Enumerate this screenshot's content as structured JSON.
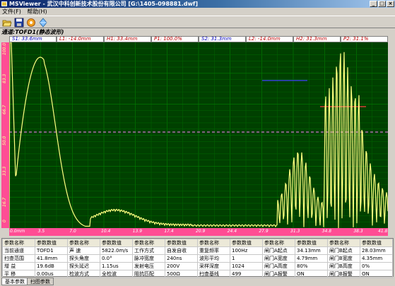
{
  "window": {
    "title": "MSViewer - 武汉中科创新技术股份有限公司 [G:\\1405-098881.dwf]"
  },
  "menu": {
    "items": [
      "文件(F)",
      "帮助(H)"
    ]
  },
  "toolbar": {
    "icons": [
      "open-folder-icon",
      "save-disk-icon",
      "settings-gear-icon",
      "diamond-icon"
    ]
  },
  "channel": {
    "label": "通道:TOFD1(静态波形)"
  },
  "readouts": [
    {
      "key": "s1",
      "text": "S1: 33.6mm"
    },
    {
      "key": "l1",
      "text": "L1: -14.0mm"
    },
    {
      "key": "h1",
      "text": "H1: 33.4mm"
    },
    {
      "key": "p1",
      "text": "P1: 100.0%"
    },
    {
      "key": "s2",
      "text": "S2: 31.3mm"
    },
    {
      "key": "l2",
      "text": "L2: -14.0mm"
    },
    {
      "key": "h2",
      "text": "H2: 31.3mm"
    },
    {
      "key": "p2",
      "text": "P2: 31.1%"
    }
  ],
  "plot": {
    "y_ticks": [
      "100.0",
      "83.3",
      "66.7",
      "50.0",
      "33.3",
      "16.7",
      "0"
    ],
    "x_ticks": [
      "0.0mm",
      "3.5",
      "7.0",
      "10.4",
      "13.9",
      "17.4",
      "20.9",
      "24.4",
      "27.9",
      "31.3",
      "34.8",
      "38.3",
      "41.8"
    ],
    "colors": {
      "background": "#004000",
      "grid": "#008000",
      "axis": "#ff4d94",
      "waveform": "#ffff80",
      "cursor": "#ff8080",
      "gate_a": "#4040ff",
      "gate_b": "#ff4040",
      "midline": "#ff80ff"
    }
  },
  "params": {
    "headers": [
      "参数名称",
      "参数数值",
      "参数名称",
      "参数数值",
      "参数名称",
      "参数数值",
      "参数名称",
      "参数数值",
      "参数名称",
      "参数数值",
      "参数名称",
      "参数数值"
    ],
    "rows": [
      [
        "当前通道",
        "TOFD1",
        "声    速",
        "5822.0m/s",
        "工作方式",
        "自发自收",
        "重复频率",
        "100Hz",
        "闸门A起点",
        "34.13mm",
        "闸门B起点",
        "28.03mm"
      ],
      [
        "扫查范围",
        "41.8mm",
        "探头角度",
        "0.0°",
        "脉冲宽度",
        "240ns",
        "波形平均",
        "1",
        "闸门A宽度",
        "4.79mm",
        "闸门B宽度",
        "4.35mm"
      ],
      [
        "增    益",
        "19.6dB",
        "探头延迟",
        "1.15us",
        "发射电压",
        "200V",
        "采样深度",
        "1024",
        "闸门A高度",
        "80%",
        "闸门B高度",
        "0%"
      ],
      [
        "平    移",
        "0.00us",
        "检波方式",
        "全检波",
        "阻抗匹配",
        "500Ω",
        "扫查基线",
        "499",
        "闸门A报警",
        "ON",
        "闸门B报警",
        "ON"
      ]
    ]
  },
  "tabs": [
    "基本参数",
    "扫图参数"
  ]
}
